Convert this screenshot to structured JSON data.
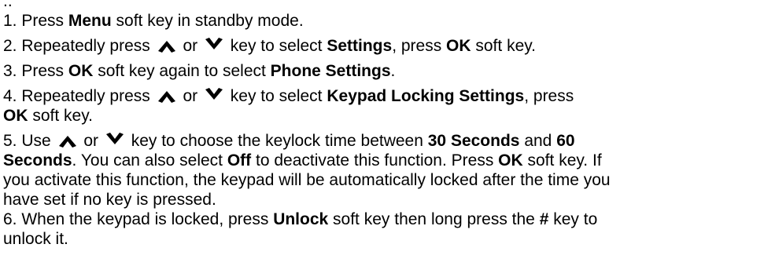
{
  "lines": [
    [
      {
        "t": "..",
        "b": false
      }
    ],
    [
      {
        "t": "1. Press ",
        "b": false
      },
      {
        "t": "Menu",
        "b": true
      },
      {
        "t": " soft key in standby mode.",
        "b": false
      }
    ],
    [
      {
        "t": "2. Repeatedly press ",
        "b": false
      },
      {
        "icon": "up-arrow-icon"
      },
      {
        "t": " or ",
        "b": false
      },
      {
        "icon": "down-arrow-icon"
      },
      {
        "t": " key to select ",
        "b": false
      },
      {
        "t": "Settings",
        "b": true
      },
      {
        "t": ", press ",
        "b": false
      },
      {
        "t": "OK",
        "b": true
      },
      {
        "t": " soft key.",
        "b": false
      }
    ],
    [
      {
        "t": "3. Press ",
        "b": false
      },
      {
        "t": "OK",
        "b": true
      },
      {
        "t": " soft key again to select ",
        "b": false
      },
      {
        "t": "Phone Settings",
        "b": true
      },
      {
        "t": ".",
        "b": false
      }
    ],
    [
      {
        "t": "4. Repeatedly press ",
        "b": false
      },
      {
        "icon": "up-arrow-icon"
      },
      {
        "t": " or ",
        "b": false
      },
      {
        "icon": "down-arrow-icon"
      },
      {
        "t": " key to select ",
        "b": false
      },
      {
        "t": "Keypad Locking Settings",
        "b": true
      },
      {
        "t": ", press",
        "b": false
      }
    ],
    [
      {
        "t": "OK",
        "b": true
      },
      {
        "t": " soft key.",
        "b": false
      }
    ],
    [
      {
        "t": "5. Use ",
        "b": false
      },
      {
        "icon": "up-arrow-icon"
      },
      {
        "t": " or ",
        "b": false
      },
      {
        "icon": "down-arrow-icon"
      },
      {
        "t": " key to choose the keylock time between ",
        "b": false
      },
      {
        "t": "30 Seconds",
        "b": true
      },
      {
        "t": " and ",
        "b": false
      },
      {
        "t": "60",
        "b": true
      }
    ],
    [
      {
        "t": "Seconds",
        "b": true
      },
      {
        "t": ". You can also select ",
        "b": false
      },
      {
        "t": "Off",
        "b": true
      },
      {
        "t": " to deactivate this function. Press ",
        "b": false
      },
      {
        "t": "OK",
        "b": true
      },
      {
        "t": " soft key. If",
        "b": false
      }
    ],
    [
      {
        "t": "you activate this function, the keypad will be automatically locked after the time you",
        "b": false
      }
    ],
    [
      {
        "t": "have set if no key is pressed.",
        "b": false
      }
    ],
    [
      {
        "t": "6. When the keypad is locked, press ",
        "b": false
      },
      {
        "t": "Unlock",
        "b": true
      },
      {
        "t": " soft key then long press the ",
        "b": false
      },
      {
        "t": "#",
        "b": true
      },
      {
        "t": " key to",
        "b": false
      }
    ],
    [
      {
        "t": "unlock it.",
        "b": false
      }
    ]
  ]
}
